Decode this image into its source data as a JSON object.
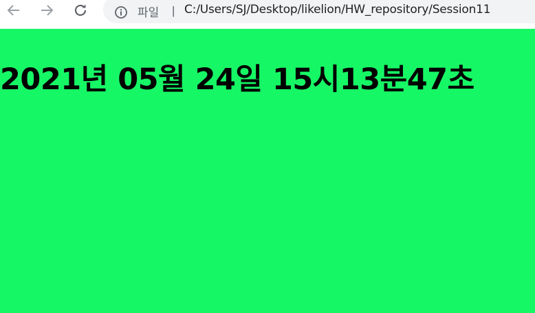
{
  "browser": {
    "icons": {
      "back": "back-arrow-icon",
      "forward": "forward-arrow-icon",
      "reload": "reload-icon",
      "info": "info-icon"
    },
    "omnibox": {
      "scheme_label": "파일",
      "url": "C:/Users/SJ/Desktop/likelion/HW_repository/Session11"
    }
  },
  "page": {
    "background_color": "#16f765",
    "clock_text": "2021년 05월 24일 15시13분47초"
  }
}
